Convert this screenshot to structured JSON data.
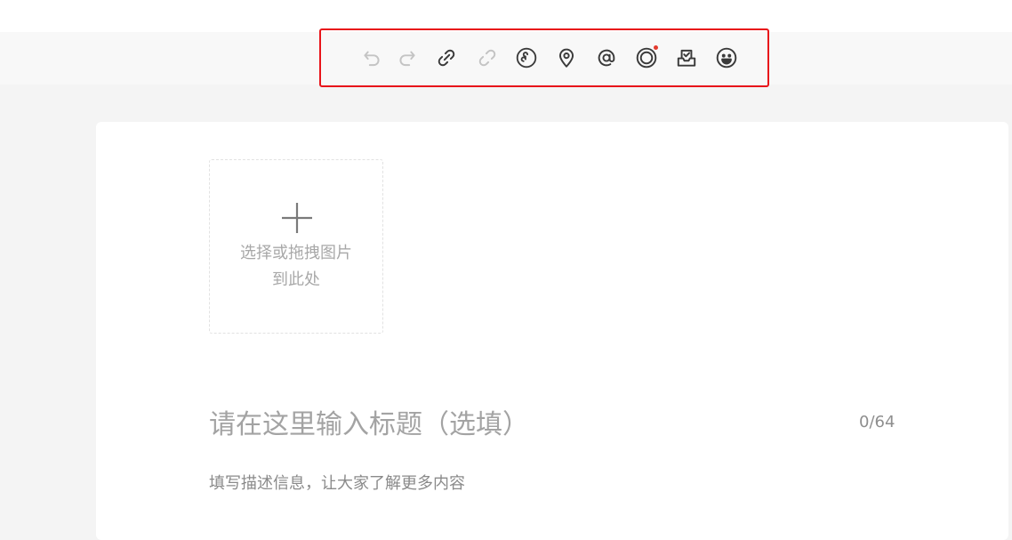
{
  "toolbar": {
    "highlight_color": "#e8141a",
    "icon_color": "#3a3a3a",
    "disabled_icon_color": "#c4c4c4",
    "tools": [
      {
        "icon": "undo-icon",
        "enabled": false
      },
      {
        "icon": "redo-icon",
        "enabled": false
      },
      {
        "icon": "link-icon",
        "enabled": true
      },
      {
        "icon": "unlink-icon",
        "enabled": false
      },
      {
        "icon": "miniprogram-icon",
        "enabled": true
      },
      {
        "icon": "location-pin-icon",
        "enabled": true
      },
      {
        "icon": "at-mention-icon",
        "enabled": true
      },
      {
        "icon": "topic-circle-icon",
        "enabled": true,
        "badge": "red-dot"
      },
      {
        "icon": "inbox-check-icon",
        "enabled": true
      },
      {
        "icon": "emoji-icon",
        "enabled": true
      }
    ]
  },
  "upload": {
    "icon": "plus-icon",
    "line1": "选择或拖拽图片",
    "line2": "到此处"
  },
  "title": {
    "placeholder": "请在这里输入标题（选填）",
    "value": "",
    "counter": "0/64"
  },
  "description": {
    "placeholder": "填写描述信息，让大家了解更多内容",
    "value": ""
  }
}
